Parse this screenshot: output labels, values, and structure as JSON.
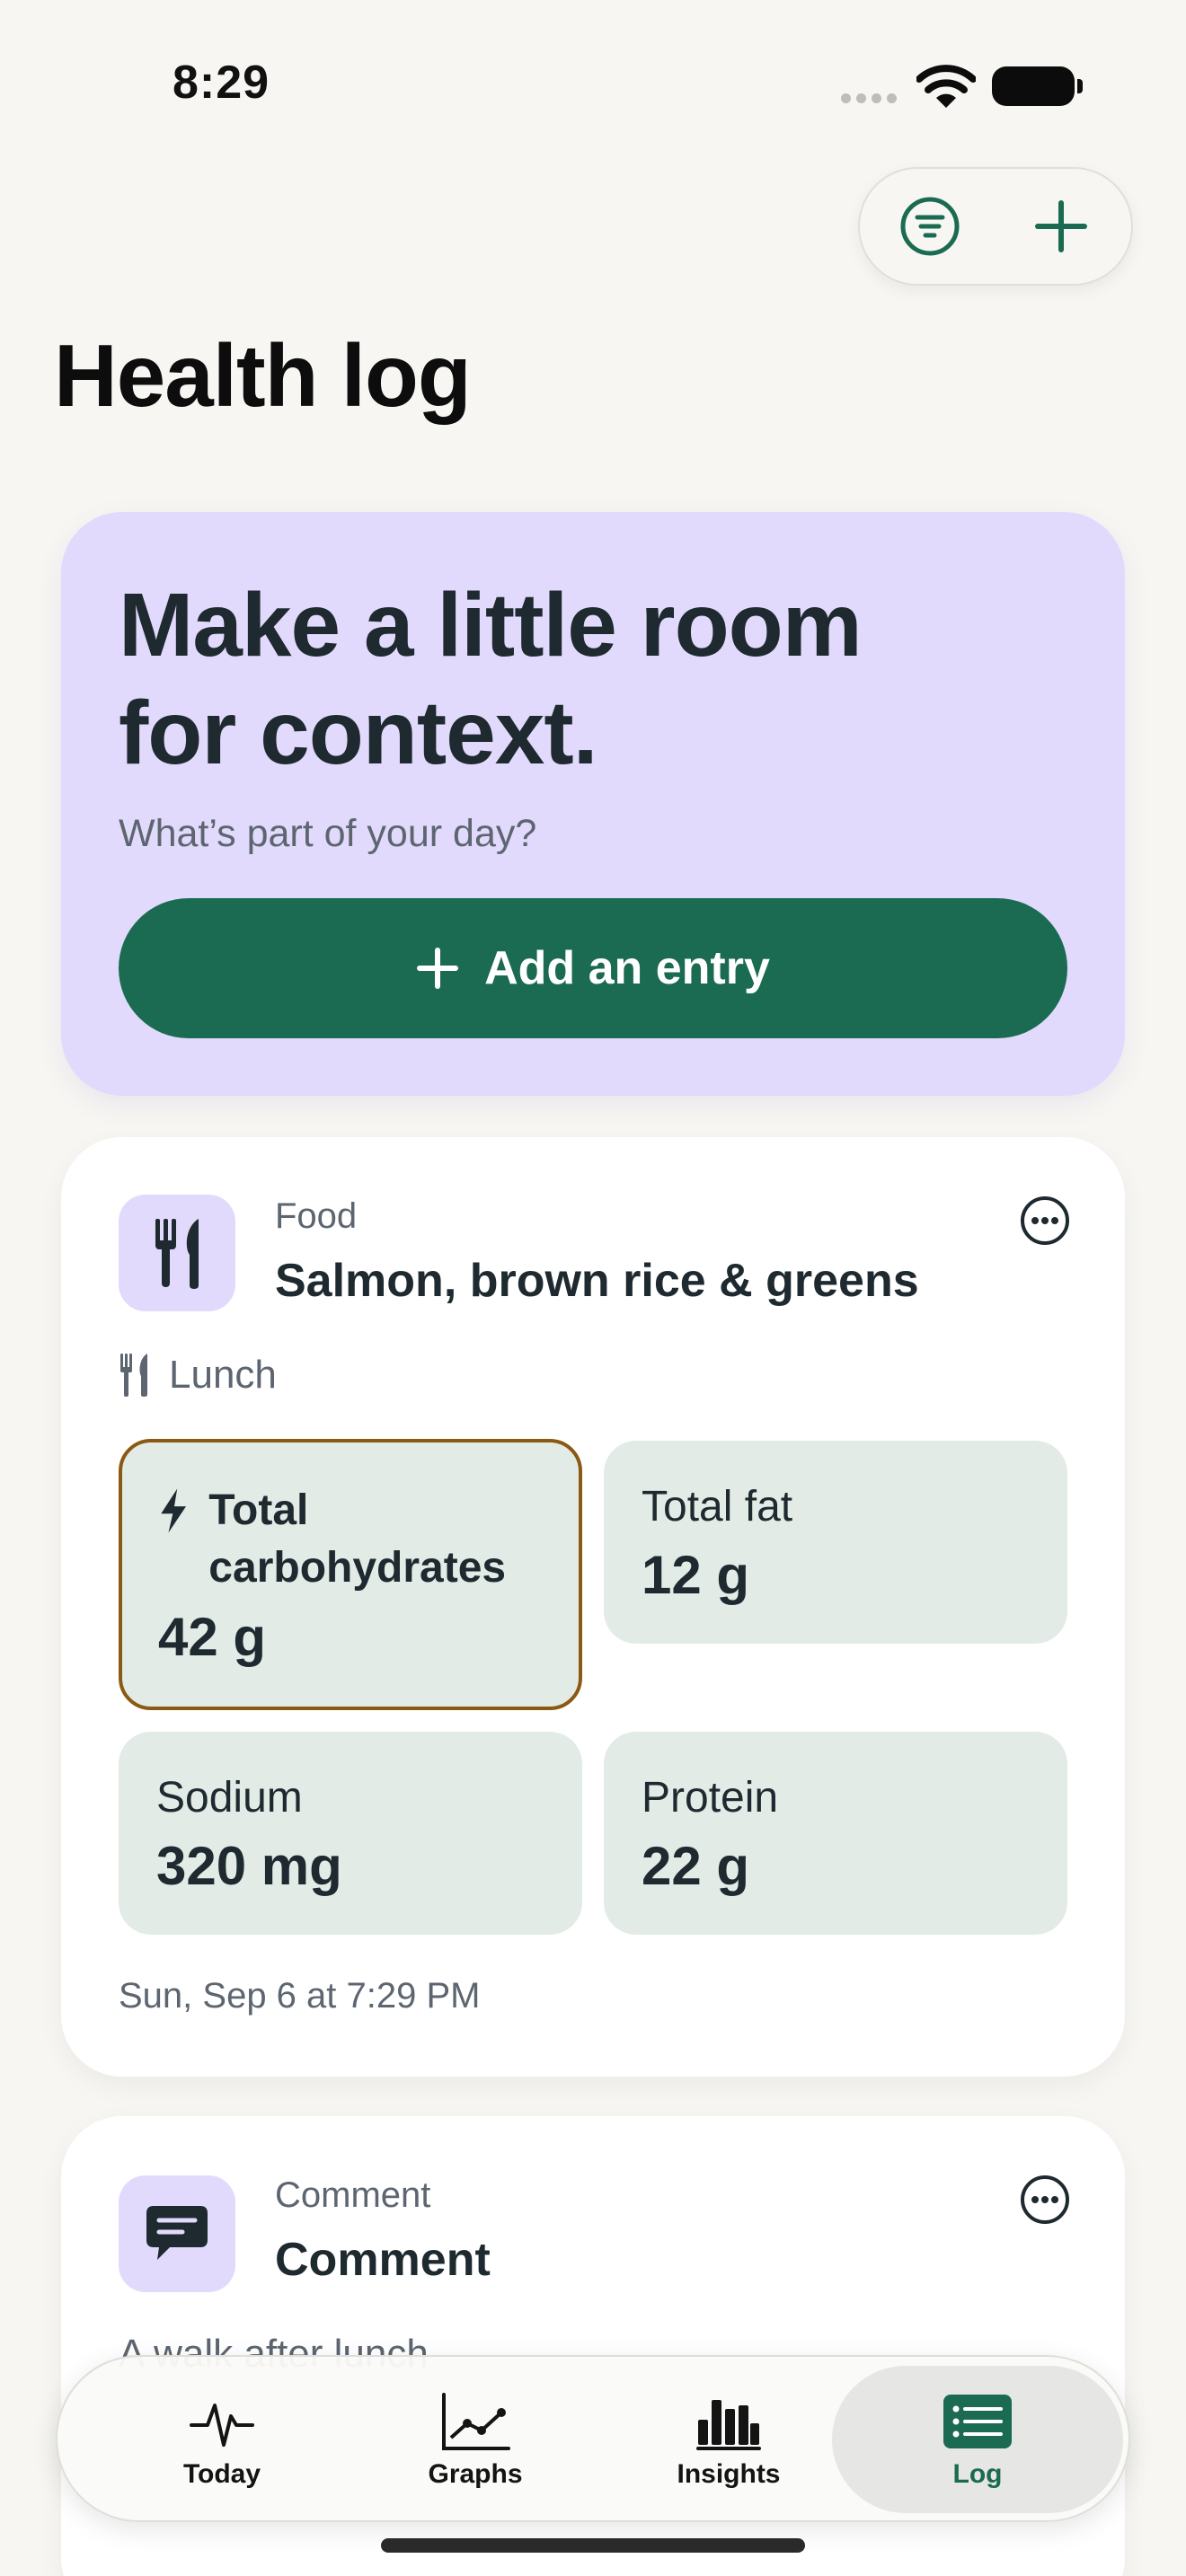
{
  "status": {
    "time": "8:29"
  },
  "page": {
    "title": "Health log"
  },
  "hero": {
    "title": "Make a little room for context.",
    "subtitle": "What’s part of your day?",
    "button_label": "Add an entry"
  },
  "food_entry": {
    "category": "Food",
    "title": "Salmon, brown rice & greens",
    "meal": "Lunch",
    "nutrients": [
      {
        "label": "Total carbohydrates",
        "value": "42 g"
      },
      {
        "label": "Total fat",
        "value": "12 g"
      },
      {
        "label": "Sodium",
        "value": "320 mg"
      },
      {
        "label": "Protein",
        "value": "22 g"
      }
    ],
    "date": "Sun, Sep 6 at 7:29 PM"
  },
  "comment_entry": {
    "category": "Comment",
    "title": "Comment",
    "text": "A walk after lunch"
  },
  "tabs": [
    {
      "label": "Today",
      "icon": "heartbeat-icon"
    },
    {
      "label": "Graphs",
      "icon": "line-graph-icon"
    },
    {
      "label": "Insights",
      "icon": "bar-chart-icon"
    },
    {
      "label": "Log",
      "icon": "list-icon",
      "active": true
    }
  ],
  "colors": {
    "accent": "#1a6b51",
    "hero_bg": "#e2dafc",
    "nutrient_bg": "#e3ebe7",
    "highlight_border": "#8a5a12"
  }
}
